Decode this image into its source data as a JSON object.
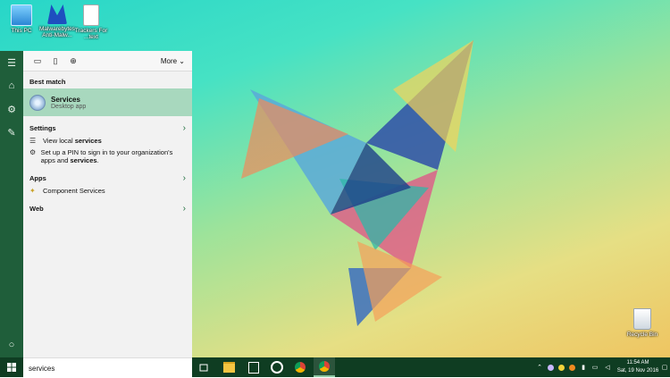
{
  "desktop": {
    "icons": [
      {
        "label": "This PC",
        "icon": "monitor-icon"
      },
      {
        "label": "Malwarebytes\nAnti-Malw...",
        "icon": "malwarebytes-icon"
      },
      {
        "label": "Trackers For\n...text",
        "icon": "text-document-icon"
      }
    ],
    "recycle_bin_label": "Recycle Bin"
  },
  "search_panel": {
    "more_label": "More",
    "best_match": {
      "heading": "Best match",
      "title": "Services",
      "subtitle": "Desktop app",
      "icon": "services-gear-icon"
    },
    "settings": {
      "heading": "Settings",
      "items": [
        {
          "text": "View local ",
          "bold": "services",
          "after": ""
        },
        {
          "text": "Set up a PIN to sign in to your organization's apps and ",
          "bold": "services",
          "after": "."
        }
      ]
    },
    "apps": {
      "heading": "Apps",
      "items": [
        {
          "text": "Component ",
          "bold": "Services",
          "after": ""
        }
      ]
    },
    "web": {
      "heading": "Web"
    }
  },
  "search_box": {
    "value": "services"
  },
  "taskbar": {
    "clock_time": "11:54 AM",
    "clock_date": "Sat, 19 Nov 2016",
    "accent_color": "#0f3d22"
  }
}
